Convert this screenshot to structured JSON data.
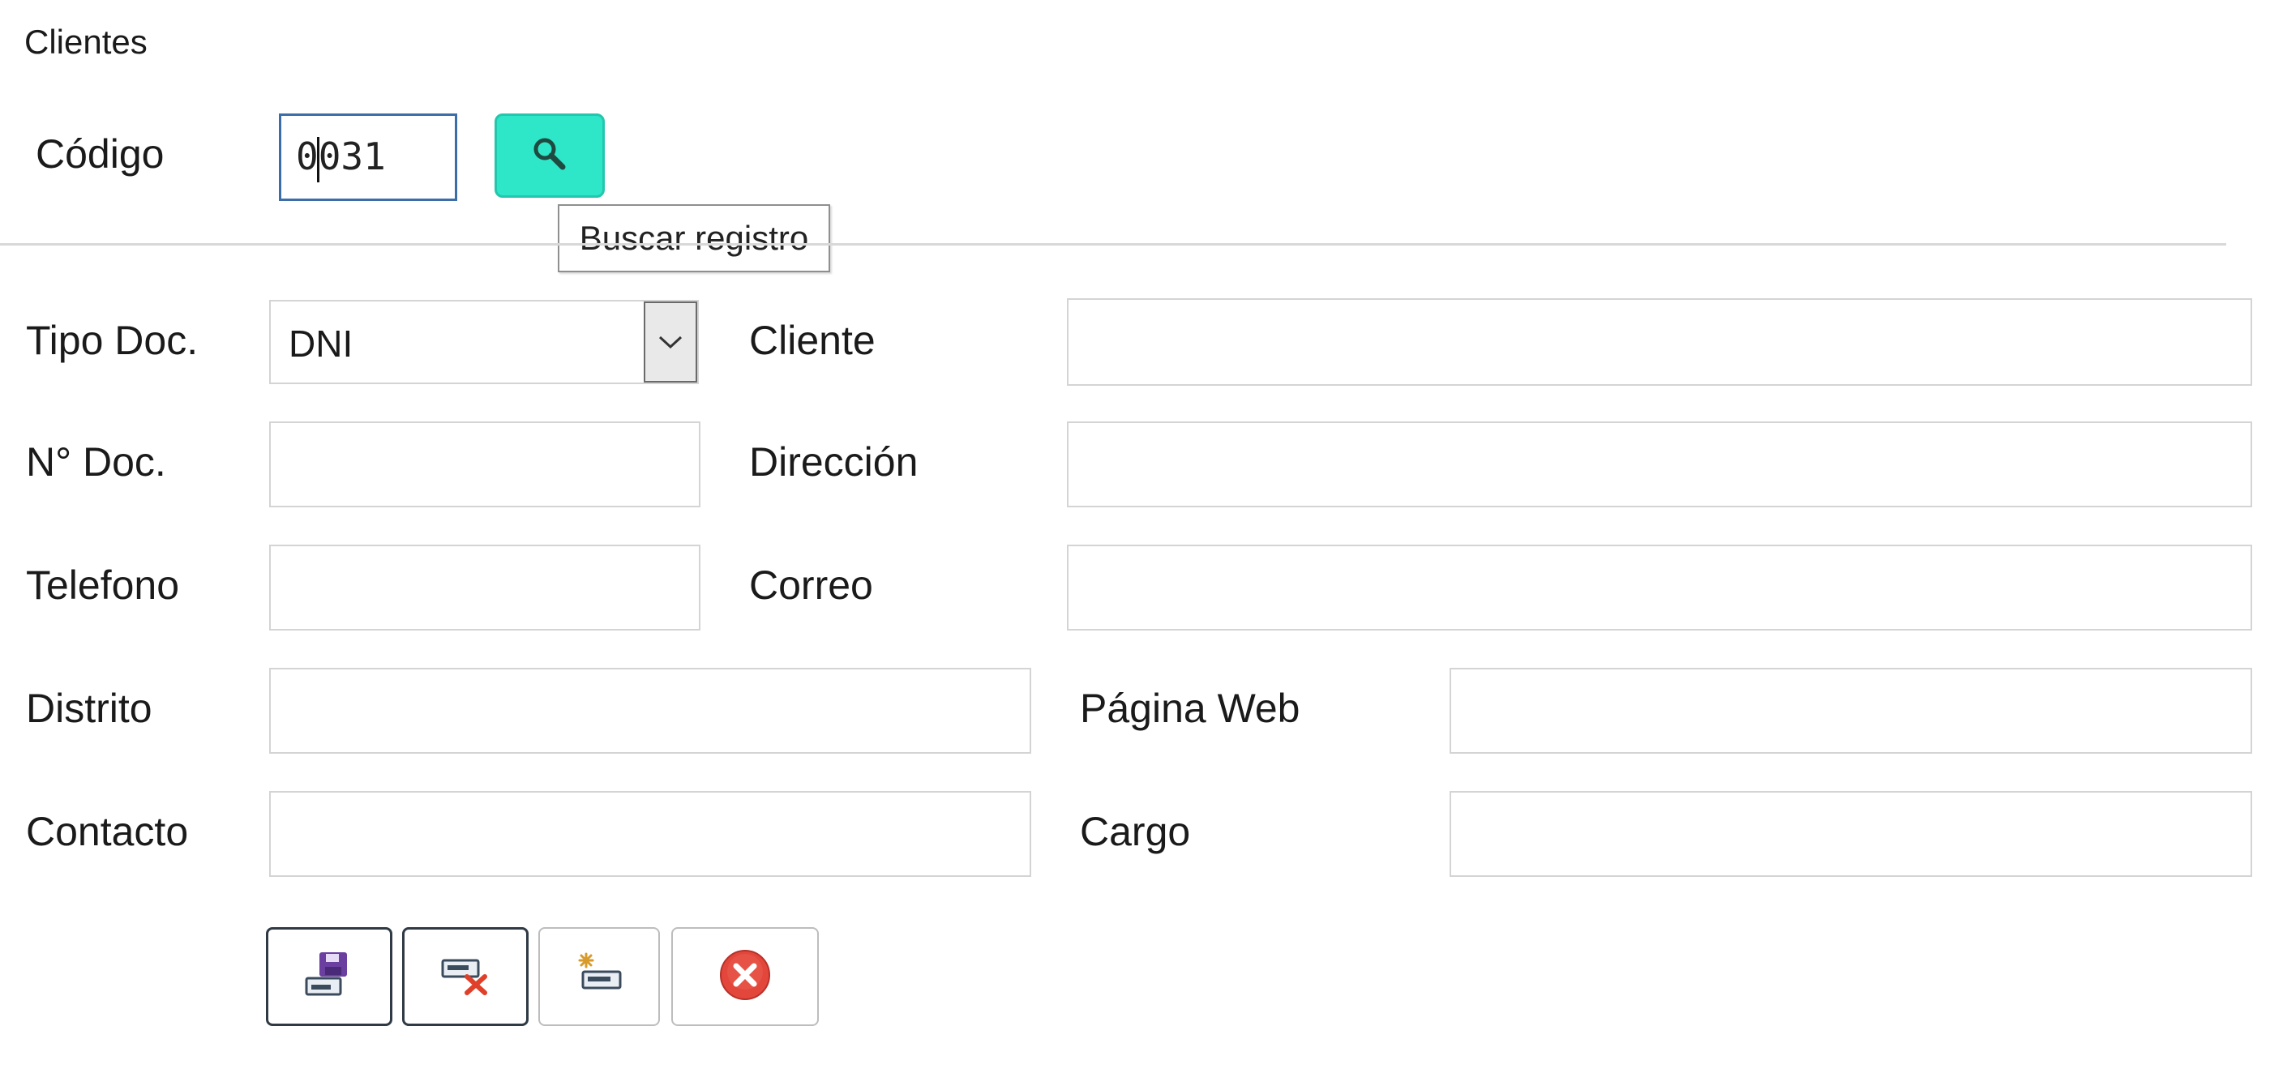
{
  "page": {
    "title": "Clientes"
  },
  "search": {
    "code_label": "Código",
    "code_value": "0031",
    "search_tooltip": "Buscar registro"
  },
  "form": {
    "tipo_doc_label": "Tipo Doc.",
    "tipo_doc_value": "DNI",
    "cliente_label": "Cliente",
    "cliente_value": "",
    "nro_doc_label": "N° Doc.",
    "nro_doc_value": "",
    "direccion_label": "Dirección",
    "direccion_value": "",
    "telefono_label": "Telefono",
    "telefono_value": "",
    "correo_label": "Correo",
    "correo_value": "",
    "distrito_label": "Distrito",
    "distrito_value": "",
    "pagina_web_label": "Página Web",
    "pagina_web_value": "",
    "contacto_label": "Contacto",
    "contacto_value": "",
    "cargo_label": "Cargo",
    "cargo_value": ""
  },
  "toolbar": {
    "icons": [
      "save-icon",
      "delete-record-icon",
      "new-record-icon",
      "close-icon"
    ],
    "colors": {
      "save": "#6a3fa0",
      "delete": "#e0402a",
      "close": "#e3463a"
    }
  },
  "colors": {
    "accent": "#2ee6c8",
    "input_focus_border": "#3b6ea8"
  }
}
